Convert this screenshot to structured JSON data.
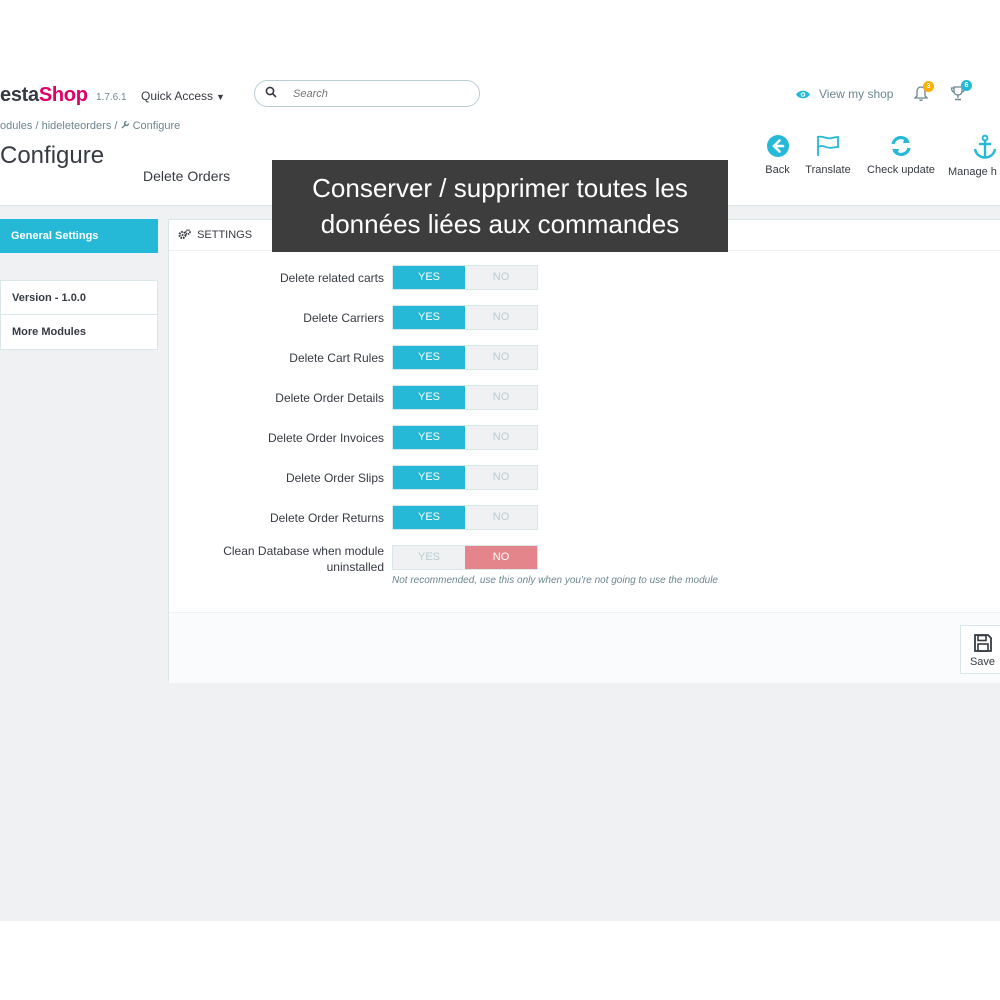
{
  "brand": {
    "logo_part1": "esta",
    "logo_part2": "Shop",
    "version": "1.7.6.1"
  },
  "header": {
    "quick_access": "Quick Access",
    "search_placeholder": "Search",
    "view_shop": "View my shop",
    "notif_count": "3",
    "trophy_count": "6"
  },
  "breadcrumb": {
    "part1": "odules",
    "sep1": "/",
    "part2": "hideleteorders",
    "sep2": "/",
    "part3": "Configure"
  },
  "page": {
    "title": "Configure",
    "subtitle": "Delete Orders"
  },
  "overlay": {
    "line1": "Conserver / supprimer toutes les",
    "line2": "données liées aux commandes"
  },
  "toolbar": {
    "back": "Back",
    "translate": "Translate",
    "check_update": "Check update",
    "manage_hooks": "Manage h"
  },
  "sidebar": {
    "active": "General Settings",
    "items": [
      "Version - 1.0.0",
      "More Modules"
    ]
  },
  "panel": {
    "heading": "SETTINGS",
    "yes": "YES",
    "no": "NO",
    "rows": [
      {
        "label": "Delete related carts",
        "value": "YES"
      },
      {
        "label": "Delete Carriers",
        "value": "YES"
      },
      {
        "label": "Delete Cart Rules",
        "value": "YES"
      },
      {
        "label": "Delete Order Details",
        "value": "YES"
      },
      {
        "label": "Delete Order Invoices",
        "value": "YES"
      },
      {
        "label": "Delete Order Slips",
        "value": "YES"
      },
      {
        "label": "Delete Order Returns",
        "value": "YES"
      },
      {
        "label": "Clean Database when module uninstalled",
        "value": "NO",
        "help": "Not recommended, use this only when you're not going to use the module"
      }
    ],
    "save": "Save"
  },
  "colors": {
    "accent": "#25b9d7",
    "danger": "#e4858b",
    "brand_pink": "#df0067"
  }
}
